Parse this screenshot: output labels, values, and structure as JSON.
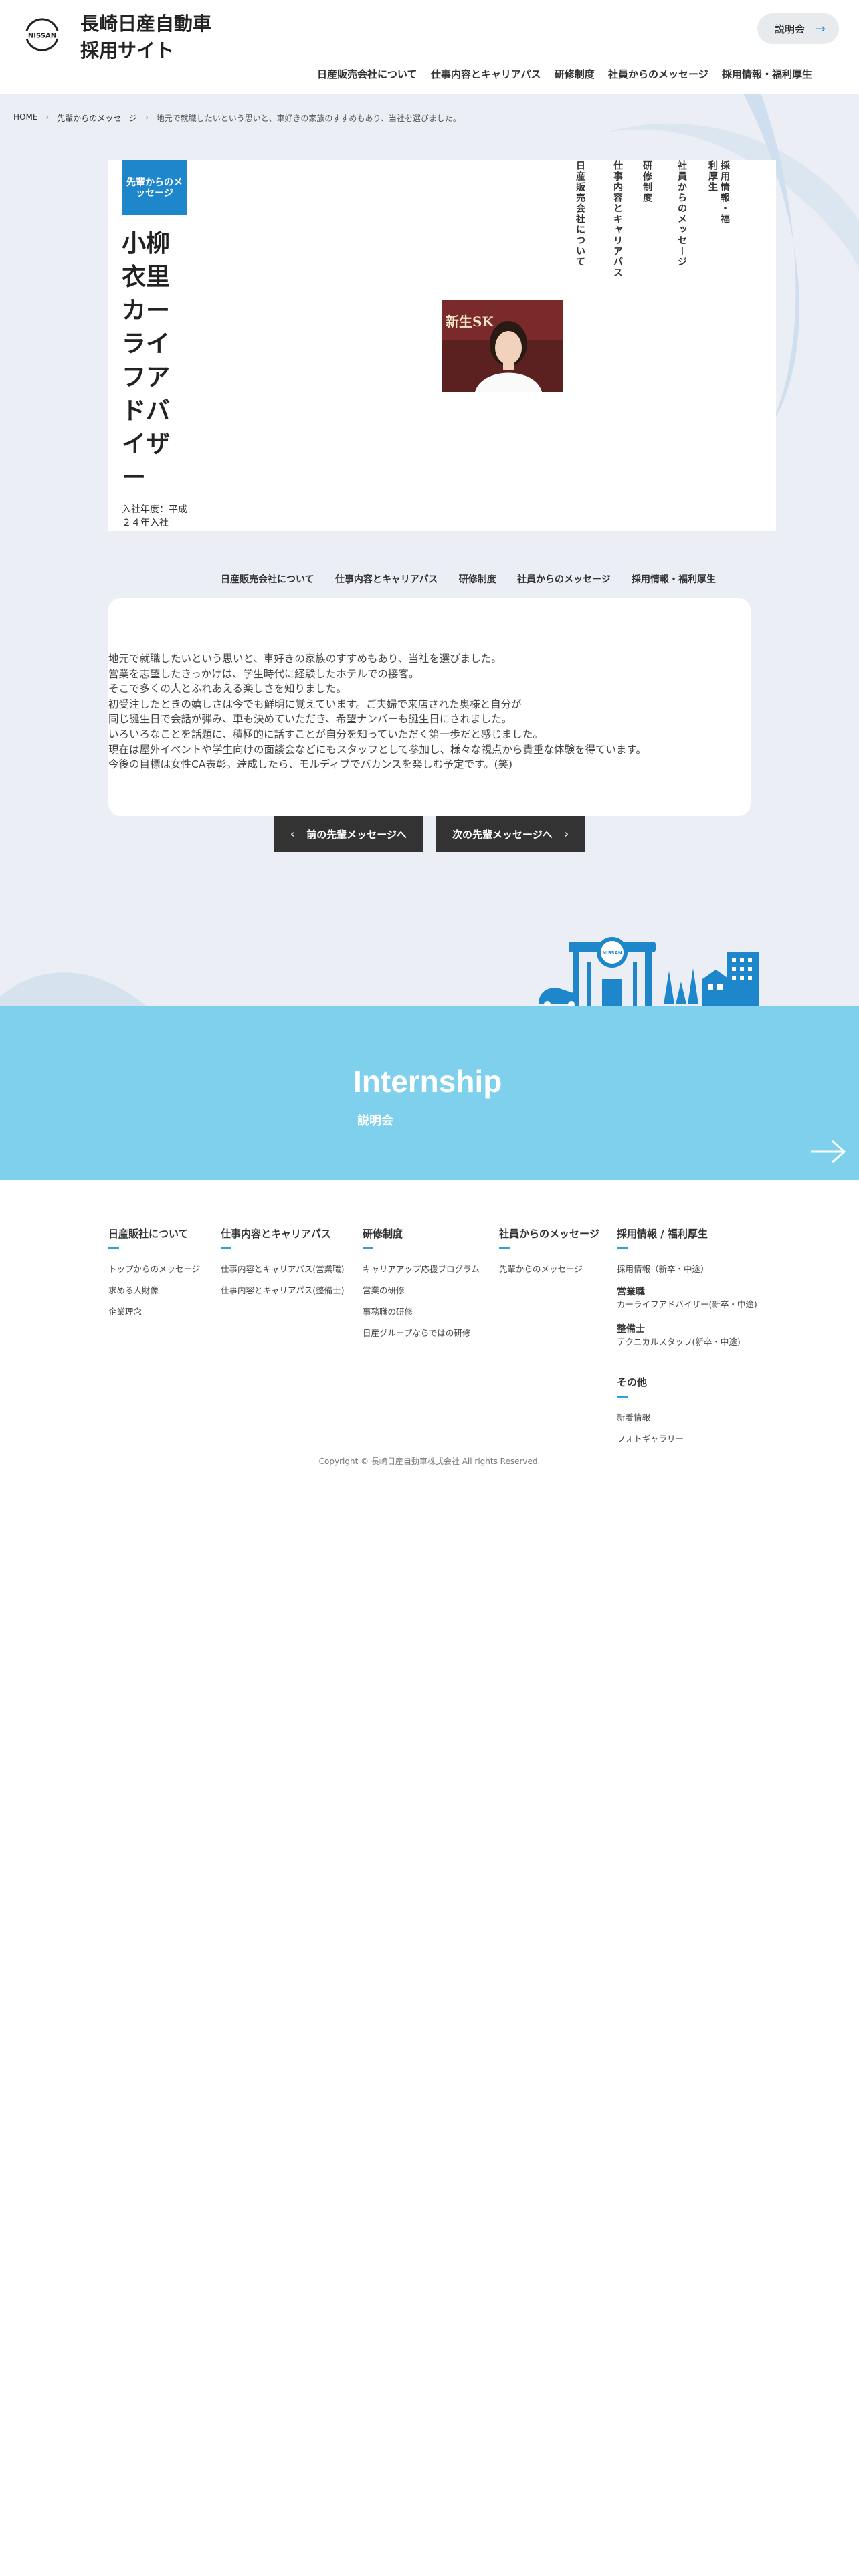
{
  "header": {
    "site_title": "長崎日産自動車\n採用サイト",
    "logo_text": "NISSAN",
    "setsumei_button": "説明会",
    "nav": [
      "日産販売会社について",
      "仕事内容とキャリアパス",
      "研修制度",
      "社員からのメッセージ",
      "採用情報・福利厚生"
    ]
  },
  "breadcrumb": [
    "HOME",
    "先輩からのメッセージ",
    "地元で就職したいという思いと、車好きの家族のすすめもあり、当社を選びました。"
  ],
  "profile": {
    "category": "先輩からのメッセージ",
    "name": "小柳衣里カーライフアドバイザー",
    "join_year": "入社年度：平成２４年入社",
    "photo_sign": "新生SK",
    "side_nav": [
      "日産販売会社について",
      "仕事内容とキャリアパス",
      "研修制度",
      "社員からのメッセージ",
      "採用情報・福利厚生"
    ]
  },
  "second_nav": [
    "日産販売会社について",
    "仕事内容とキャリアパス",
    "研修制度",
    "社員からのメッセージ",
    "採用情報・福利厚生"
  ],
  "message": {
    "lines": [
      "地元で就職したいという思いと、車好きの家族のすすめもあり、当社を選びました。",
      "営業を志望したきっかけは、学生時代に経験したホテルでの接客。",
      "そこで多くの人とふれあえる楽しさを知りました。",
      "初受注したときの嬉しさは今でも鮮明に覚えています。ご夫婦で来店された奥様と自分が",
      "同じ誕生日で会話が弾み、車も決めていただき、希望ナンバーも誕生日にされました。",
      "いろいろなことを話題に、積極的に話すことが自分を知っていただく第一歩だと感じました。",
      "現在は屋外イベントや学生向けの面談会などにもスタッフとして参加し、様々な視点から貴重な体験を得ています。",
      "今後の目標は女性CA表彰。達成したら、モルディブでバカンスを楽しむ予定です。(笑)"
    ]
  },
  "pager": {
    "prev": "前の先輩メッセージへ",
    "next": "次の先輩メッセージへ"
  },
  "illustration": {
    "sign_text": "NISSAN"
  },
  "internship": {
    "title": "Internship",
    "subtitle": "説明会"
  },
  "footer": {
    "columns": [
      {
        "heading": "日産販社について",
        "links": [
          "トップからのメッセージ",
          "求める人財像",
          "企業理念"
        ]
      },
      {
        "heading": "仕事内容とキャリアパス",
        "links": [
          "仕事内容とキャリアパス(営業職)",
          "仕事内容とキャリアパス(整備士)"
        ]
      },
      {
        "heading": "研修制度",
        "links": [
          "キャリアアップ応援プログラム",
          "営業の研修",
          "事務職の研修",
          "日産グループならではの研修"
        ]
      },
      {
        "heading": "社員からのメッセージ",
        "links": [
          "先輩からのメッセージ"
        ]
      },
      {
        "heading": "採用情報 / 福利厚生",
        "links": [
          "採用情報（新卒・中途）"
        ],
        "groups": [
          {
            "title": "営業職",
            "item": "カーライフアドバイザー(新卒・中途)"
          },
          {
            "title": "整備士",
            "item": "テクニカルスタッフ(新卒・中途)"
          }
        ],
        "other_heading": "その他",
        "other_links": [
          "新着情報",
          "フォトギャラリー"
        ]
      }
    ],
    "copyright": "Copyright © 長崎日産自動車株式会社 All rights Reserved."
  }
}
